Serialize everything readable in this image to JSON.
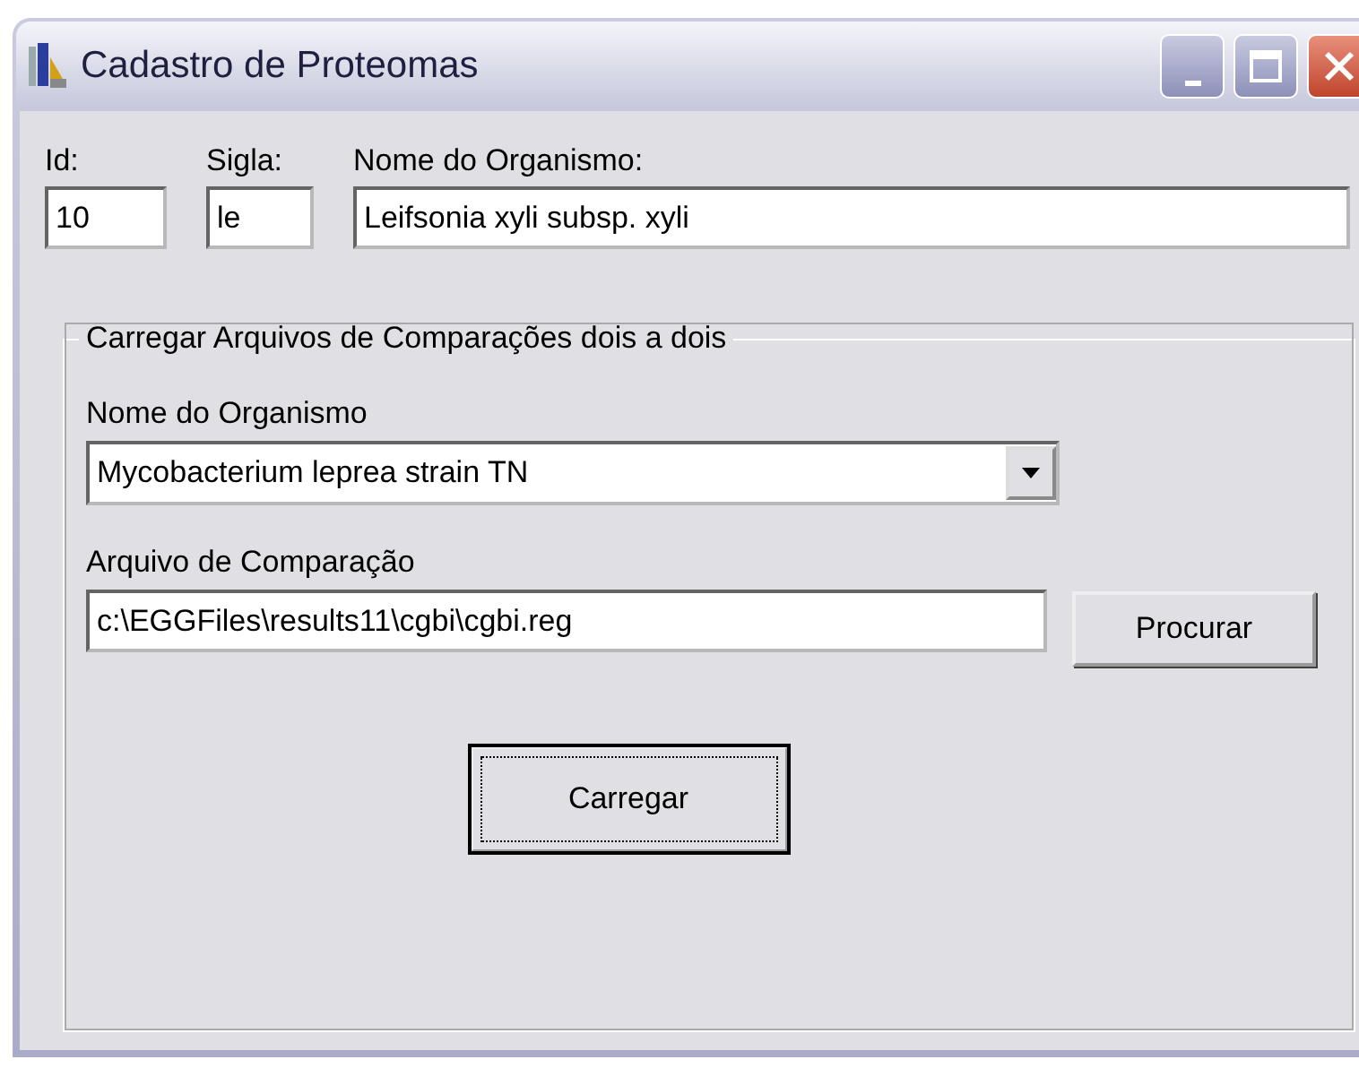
{
  "window": {
    "title": "Cadastro de Proteomas"
  },
  "fields": [
    {
      "label": "Id:",
      "value": "10"
    },
    {
      "label": "Sigla:",
      "value": "le"
    },
    {
      "label": "Nome do Organismo:",
      "value": "Leifsonia xyli subsp. xyli"
    }
  ],
  "group": {
    "title": "Carregar Arquivos de Comparações dois a dois",
    "organism": {
      "label": "Nome do Organismo",
      "value": "Mycobacterium leprea strain TN"
    },
    "file": {
      "label": "Arquivo de Comparação",
      "value": "c:\\EGGFiles\\results11\\cgbi\\cgbi.reg"
    },
    "browse_button": {
      "label": "Procurar",
      "focused": false
    },
    "load_button": {
      "label": "Carregar",
      "focused": true
    }
  }
}
